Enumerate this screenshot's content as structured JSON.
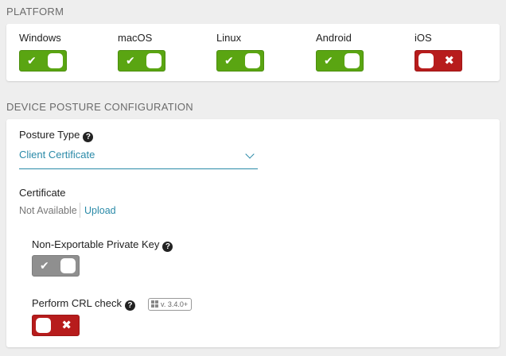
{
  "platform": {
    "title": "PLATFORM",
    "items": [
      {
        "label": "Windows",
        "state": "on",
        "glyph": "✔"
      },
      {
        "label": "macOS",
        "state": "on",
        "glyph": "✔"
      },
      {
        "label": "Linux",
        "state": "on",
        "glyph": "✔"
      },
      {
        "label": "Android",
        "state": "on",
        "glyph": "✔"
      },
      {
        "label": "iOS",
        "state": "off",
        "glyph": "✖"
      }
    ]
  },
  "device_posture": {
    "title": "DEVICE POSTURE CONFIGURATION",
    "posture_type": {
      "label": "Posture Type",
      "help_glyph": "?",
      "value": "Client Certificate"
    },
    "certificate": {
      "label": "Certificate",
      "status": "Not Available",
      "upload_label": "Upload"
    },
    "non_exportable_key": {
      "label": "Non-Exportable Private Key",
      "help_glyph": "?",
      "state": "disabled-on",
      "glyph": "✔"
    },
    "crl_check": {
      "label": "Perform CRL check",
      "help_glyph": "?",
      "version_badge": "v. 3.4.0+",
      "state": "off",
      "glyph": "✖"
    }
  },
  "colors": {
    "toggle_on": "#5aa512",
    "toggle_off": "#b71c1c",
    "toggle_disabled": "#8f8f8f",
    "link": "#2a8aa8"
  },
  "icons": {
    "check": "check-icon",
    "close": "close-icon",
    "help": "help-circle-icon",
    "windows": "windows-logo-icon",
    "dropdown": "chevron-down-icon"
  }
}
